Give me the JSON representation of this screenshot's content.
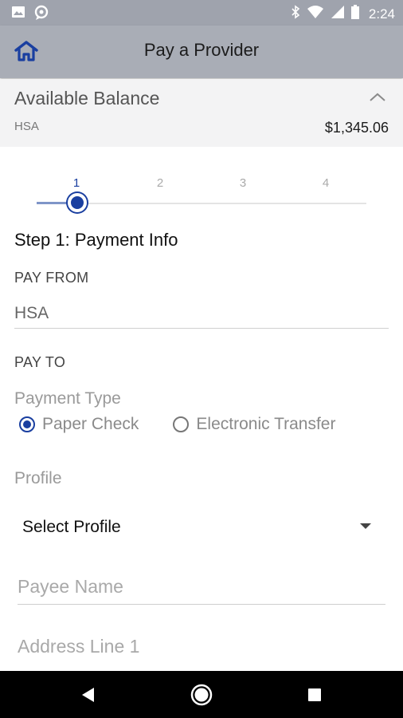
{
  "status_bar": {
    "time": "2:24"
  },
  "app_bar": {
    "title": "Pay a Provider"
  },
  "balance": {
    "title": "Available Balance",
    "account": "HSA",
    "amount": "$1,345.06"
  },
  "stepper": {
    "steps": [
      "1",
      "2",
      "3",
      "4"
    ],
    "current_step": 1
  },
  "step_title": "Step 1: Payment Info",
  "pay_from": {
    "label": "PAY FROM",
    "value": "HSA"
  },
  "pay_to": {
    "label": "PAY TO"
  },
  "payment_type": {
    "label": "Payment Type",
    "options": [
      "Paper Check",
      "Electronic Transfer"
    ],
    "selected": "Paper Check"
  },
  "profile": {
    "label": "Profile",
    "selected": "Select Profile"
  },
  "payee_name": {
    "placeholder": "Payee Name",
    "value": ""
  },
  "address_line1": {
    "placeholder": "Address Line 1",
    "value": ""
  },
  "colors": {
    "accent": "#1a3fa0",
    "app_bar": "#a9adb6",
    "status_bar": "#9fa3ad"
  }
}
